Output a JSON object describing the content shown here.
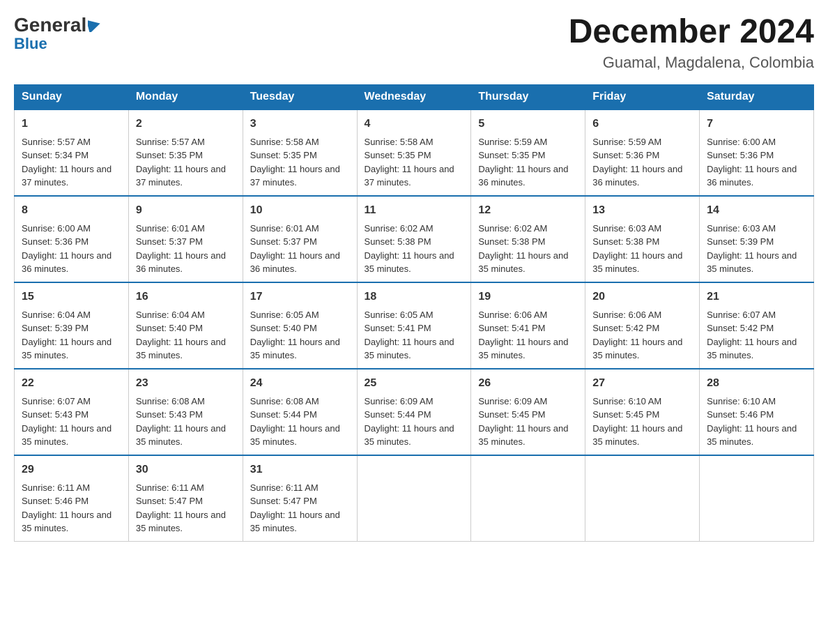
{
  "header": {
    "logo": {
      "general": "General",
      "blue": "Blue",
      "arrow": "▶"
    },
    "month_year": "December 2024",
    "location": "Guamal, Magdalena, Colombia"
  },
  "calendar": {
    "days_of_week": [
      "Sunday",
      "Monday",
      "Tuesday",
      "Wednesday",
      "Thursday",
      "Friday",
      "Saturday"
    ],
    "weeks": [
      [
        {
          "day": "1",
          "sunrise": "Sunrise: 5:57 AM",
          "sunset": "Sunset: 5:34 PM",
          "daylight": "Daylight: 11 hours and 37 minutes."
        },
        {
          "day": "2",
          "sunrise": "Sunrise: 5:57 AM",
          "sunset": "Sunset: 5:35 PM",
          "daylight": "Daylight: 11 hours and 37 minutes."
        },
        {
          "day": "3",
          "sunrise": "Sunrise: 5:58 AM",
          "sunset": "Sunset: 5:35 PM",
          "daylight": "Daylight: 11 hours and 37 minutes."
        },
        {
          "day": "4",
          "sunrise": "Sunrise: 5:58 AM",
          "sunset": "Sunset: 5:35 PM",
          "daylight": "Daylight: 11 hours and 37 minutes."
        },
        {
          "day": "5",
          "sunrise": "Sunrise: 5:59 AM",
          "sunset": "Sunset: 5:35 PM",
          "daylight": "Daylight: 11 hours and 36 minutes."
        },
        {
          "day": "6",
          "sunrise": "Sunrise: 5:59 AM",
          "sunset": "Sunset: 5:36 PM",
          "daylight": "Daylight: 11 hours and 36 minutes."
        },
        {
          "day": "7",
          "sunrise": "Sunrise: 6:00 AM",
          "sunset": "Sunset: 5:36 PM",
          "daylight": "Daylight: 11 hours and 36 minutes."
        }
      ],
      [
        {
          "day": "8",
          "sunrise": "Sunrise: 6:00 AM",
          "sunset": "Sunset: 5:36 PM",
          "daylight": "Daylight: 11 hours and 36 minutes."
        },
        {
          "day": "9",
          "sunrise": "Sunrise: 6:01 AM",
          "sunset": "Sunset: 5:37 PM",
          "daylight": "Daylight: 11 hours and 36 minutes."
        },
        {
          "day": "10",
          "sunrise": "Sunrise: 6:01 AM",
          "sunset": "Sunset: 5:37 PM",
          "daylight": "Daylight: 11 hours and 36 minutes."
        },
        {
          "day": "11",
          "sunrise": "Sunrise: 6:02 AM",
          "sunset": "Sunset: 5:38 PM",
          "daylight": "Daylight: 11 hours and 35 minutes."
        },
        {
          "day": "12",
          "sunrise": "Sunrise: 6:02 AM",
          "sunset": "Sunset: 5:38 PM",
          "daylight": "Daylight: 11 hours and 35 minutes."
        },
        {
          "day": "13",
          "sunrise": "Sunrise: 6:03 AM",
          "sunset": "Sunset: 5:38 PM",
          "daylight": "Daylight: 11 hours and 35 minutes."
        },
        {
          "day": "14",
          "sunrise": "Sunrise: 6:03 AM",
          "sunset": "Sunset: 5:39 PM",
          "daylight": "Daylight: 11 hours and 35 minutes."
        }
      ],
      [
        {
          "day": "15",
          "sunrise": "Sunrise: 6:04 AM",
          "sunset": "Sunset: 5:39 PM",
          "daylight": "Daylight: 11 hours and 35 minutes."
        },
        {
          "day": "16",
          "sunrise": "Sunrise: 6:04 AM",
          "sunset": "Sunset: 5:40 PM",
          "daylight": "Daylight: 11 hours and 35 minutes."
        },
        {
          "day": "17",
          "sunrise": "Sunrise: 6:05 AM",
          "sunset": "Sunset: 5:40 PM",
          "daylight": "Daylight: 11 hours and 35 minutes."
        },
        {
          "day": "18",
          "sunrise": "Sunrise: 6:05 AM",
          "sunset": "Sunset: 5:41 PM",
          "daylight": "Daylight: 11 hours and 35 minutes."
        },
        {
          "day": "19",
          "sunrise": "Sunrise: 6:06 AM",
          "sunset": "Sunset: 5:41 PM",
          "daylight": "Daylight: 11 hours and 35 minutes."
        },
        {
          "day": "20",
          "sunrise": "Sunrise: 6:06 AM",
          "sunset": "Sunset: 5:42 PM",
          "daylight": "Daylight: 11 hours and 35 minutes."
        },
        {
          "day": "21",
          "sunrise": "Sunrise: 6:07 AM",
          "sunset": "Sunset: 5:42 PM",
          "daylight": "Daylight: 11 hours and 35 minutes."
        }
      ],
      [
        {
          "day": "22",
          "sunrise": "Sunrise: 6:07 AM",
          "sunset": "Sunset: 5:43 PM",
          "daylight": "Daylight: 11 hours and 35 minutes."
        },
        {
          "day": "23",
          "sunrise": "Sunrise: 6:08 AM",
          "sunset": "Sunset: 5:43 PM",
          "daylight": "Daylight: 11 hours and 35 minutes."
        },
        {
          "day": "24",
          "sunrise": "Sunrise: 6:08 AM",
          "sunset": "Sunset: 5:44 PM",
          "daylight": "Daylight: 11 hours and 35 minutes."
        },
        {
          "day": "25",
          "sunrise": "Sunrise: 6:09 AM",
          "sunset": "Sunset: 5:44 PM",
          "daylight": "Daylight: 11 hours and 35 minutes."
        },
        {
          "day": "26",
          "sunrise": "Sunrise: 6:09 AM",
          "sunset": "Sunset: 5:45 PM",
          "daylight": "Daylight: 11 hours and 35 minutes."
        },
        {
          "day": "27",
          "sunrise": "Sunrise: 6:10 AM",
          "sunset": "Sunset: 5:45 PM",
          "daylight": "Daylight: 11 hours and 35 minutes."
        },
        {
          "day": "28",
          "sunrise": "Sunrise: 6:10 AM",
          "sunset": "Sunset: 5:46 PM",
          "daylight": "Daylight: 11 hours and 35 minutes."
        }
      ],
      [
        {
          "day": "29",
          "sunrise": "Sunrise: 6:11 AM",
          "sunset": "Sunset: 5:46 PM",
          "daylight": "Daylight: 11 hours and 35 minutes."
        },
        {
          "day": "30",
          "sunrise": "Sunrise: 6:11 AM",
          "sunset": "Sunset: 5:47 PM",
          "daylight": "Daylight: 11 hours and 35 minutes."
        },
        {
          "day": "31",
          "sunrise": "Sunrise: 6:11 AM",
          "sunset": "Sunset: 5:47 PM",
          "daylight": "Daylight: 11 hours and 35 minutes."
        },
        null,
        null,
        null,
        null
      ]
    ]
  }
}
